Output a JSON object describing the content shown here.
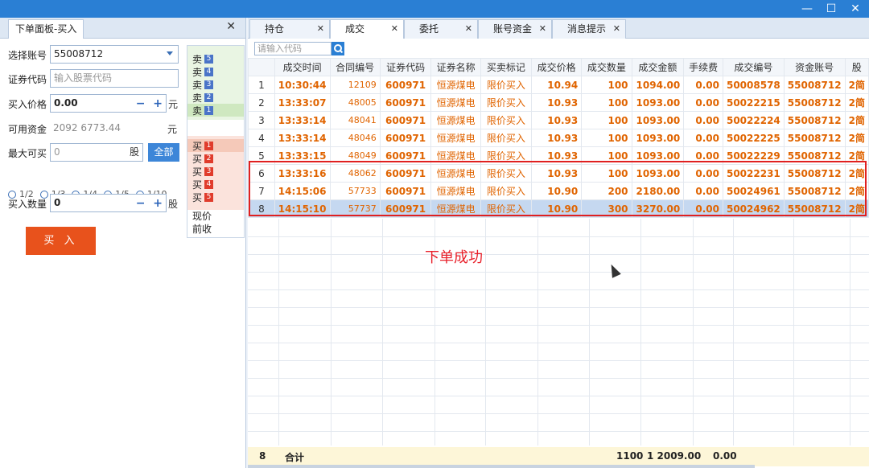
{
  "window": {
    "minimize": "—",
    "maximize": "☐",
    "close": "✕"
  },
  "left_panel": {
    "tab_label": "下单面板-买入",
    "close": "✕",
    "account_label": "选择账号",
    "account_value": "55008712",
    "code_label": "证券代码",
    "code_placeholder": "输入股票代码",
    "price_label": "买入价格",
    "price_value": "0.00",
    "price_unit": "元",
    "funds_label": "可用资金",
    "funds_value": "2092 6773.44",
    "funds_unit": "元",
    "max_label": "最大可买",
    "max_value": "0",
    "max_unit": "股",
    "all_button": "全部",
    "ratios": [
      "1/2",
      "1/3",
      "1/4",
      "1/5",
      "1/10"
    ],
    "qty_label": "买入数量",
    "qty_value": "0",
    "qty_unit": "股",
    "buy_button": "买 入",
    "minus": "−",
    "plus": "+"
  },
  "order_book": {
    "sell": [
      {
        "label": "卖",
        "n": "5"
      },
      {
        "label": "卖",
        "n": "4"
      },
      {
        "label": "卖",
        "n": "3"
      },
      {
        "label": "卖",
        "n": "2"
      },
      {
        "label": "卖",
        "n": "1"
      }
    ],
    "buy": [
      {
        "label": "买",
        "n": "1"
      },
      {
        "label": "买",
        "n": "2"
      },
      {
        "label": "买",
        "n": "3"
      },
      {
        "label": "买",
        "n": "4"
      },
      {
        "label": "买",
        "n": "5"
      }
    ],
    "current_price": "现价",
    "prev_close": "前收"
  },
  "tabs": [
    {
      "label": "持仓",
      "close": "✕"
    },
    {
      "label": "成交",
      "close": "✕"
    },
    {
      "label": "委托",
      "close": "✕"
    },
    {
      "label": "账号资金",
      "close": "✕"
    },
    {
      "label": "消息提示",
      "close": "✕"
    }
  ],
  "search_placeholder": "请输入代码",
  "columns": [
    "",
    "成交时间",
    "合同编号",
    "证券代码",
    "证券名称",
    "买卖标记",
    "成交价格",
    "成交数量",
    "成交金额",
    "手续费",
    "成交编号",
    "资金账号",
    "股"
  ],
  "rows": [
    [
      "1",
      "10:30:44",
      "12109",
      "600971",
      "恒源煤电",
      "限价买入",
      "10.94",
      "100",
      "1094.00",
      "0.00",
      "50008578",
      "55008712",
      "2简"
    ],
    [
      "2",
      "13:33:07",
      "48005",
      "600971",
      "恒源煤电",
      "限价买入",
      "10.93",
      "100",
      "1093.00",
      "0.00",
      "50022215",
      "55008712",
      "2简"
    ],
    [
      "3",
      "13:33:14",
      "48041",
      "600971",
      "恒源煤电",
      "限价买入",
      "10.93",
      "100",
      "1093.00",
      "0.00",
      "50022224",
      "55008712",
      "2简"
    ],
    [
      "4",
      "13:33:14",
      "48046",
      "600971",
      "恒源煤电",
      "限价买入",
      "10.93",
      "100",
      "1093.00",
      "0.00",
      "50022225",
      "55008712",
      "2简"
    ],
    [
      "5",
      "13:33:15",
      "48049",
      "600971",
      "恒源煤电",
      "限价买入",
      "10.93",
      "100",
      "1093.00",
      "0.00",
      "50022229",
      "55008712",
      "2简"
    ],
    [
      "6",
      "13:33:16",
      "48062",
      "600971",
      "恒源煤电",
      "限价买入",
      "10.93",
      "100",
      "1093.00",
      "0.00",
      "50022231",
      "55008712",
      "2简"
    ],
    [
      "7",
      "14:15:06",
      "57733",
      "600971",
      "恒源煤电",
      "限价买入",
      "10.90",
      "200",
      "2180.00",
      "0.00",
      "50024961",
      "55008712",
      "2简"
    ],
    [
      "8",
      "14:15:10",
      "57737",
      "600971",
      "恒源煤电",
      "限价买入",
      "10.90",
      "300",
      "3270.00",
      "0.00",
      "50024962",
      "55008712",
      "2简"
    ]
  ],
  "success_message": "下单成功",
  "totals": {
    "count": "8",
    "label": "合计",
    "qty": "1100",
    "amount": "1 2009.00",
    "fee": "0.00"
  }
}
